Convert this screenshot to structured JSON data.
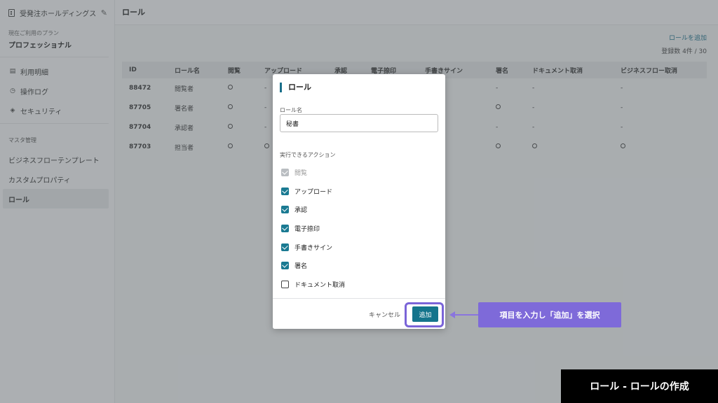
{
  "sidebar": {
    "company": "受発注ホールディングス",
    "plan_label": "現在ご利用のプラン",
    "plan_value": "プロフェッショナル",
    "items": [
      {
        "label": "利用明細",
        "icon": "receipt-icon"
      },
      {
        "label": "操作ログ",
        "icon": "history-icon"
      },
      {
        "label": "セキュリティ",
        "icon": "shield-icon"
      }
    ],
    "section_title": "マスタ管理",
    "master_items": [
      {
        "label": "ビジネスフローテンプレート"
      },
      {
        "label": "カスタムプロパティ"
      },
      {
        "label": "ロール"
      }
    ]
  },
  "main": {
    "title": "ロール",
    "add_link": "ロールを追加",
    "count": "登録数 4件 / 30",
    "columns": [
      "ID",
      "ロール名",
      "閲覧",
      "アップロード",
      "承認",
      "電子捺印",
      "手書きサイン",
      "署名",
      "ドキュメント取消",
      "ビジネスフロー取消"
    ],
    "rows": [
      {
        "id": "88472",
        "name": "閲覧者",
        "cells": [
          "○",
          "-",
          "",
          "",
          "",
          "-",
          "-",
          "-"
        ]
      },
      {
        "id": "87705",
        "name": "署名者",
        "cells": [
          "○",
          "-",
          "",
          "",
          "",
          "○",
          "-",
          "-"
        ]
      },
      {
        "id": "87704",
        "name": "承認者",
        "cells": [
          "○",
          "-",
          "",
          "",
          "",
          "-",
          "-",
          "-"
        ]
      },
      {
        "id": "87703",
        "name": "担当者",
        "cells": [
          "○",
          "○",
          "",
          "",
          "",
          "○",
          "○",
          "○"
        ]
      }
    ]
  },
  "modal": {
    "title": "ロール",
    "name_label": "ロール名",
    "name_value": "秘書",
    "actions_label": "実行できるアクション",
    "actions": [
      {
        "label": "閲覧",
        "checked": true,
        "disabled": true
      },
      {
        "label": "アップロード",
        "checked": true,
        "disabled": false
      },
      {
        "label": "承認",
        "checked": true,
        "disabled": false
      },
      {
        "label": "電子捺印",
        "checked": true,
        "disabled": false
      },
      {
        "label": "手書きサイン",
        "checked": true,
        "disabled": false
      },
      {
        "label": "署名",
        "checked": true,
        "disabled": false
      },
      {
        "label": "ドキュメント取消",
        "checked": false,
        "disabled": false
      }
    ],
    "cancel_label": "キャンセル",
    "add_label": "追加"
  },
  "callout": "項目を入力し「追加」を選択",
  "caption": "ロール - ロールの作成",
  "colors": {
    "accent": "#14748c",
    "highlight": "#7a64d8",
    "callout": "#7e6ad9"
  }
}
